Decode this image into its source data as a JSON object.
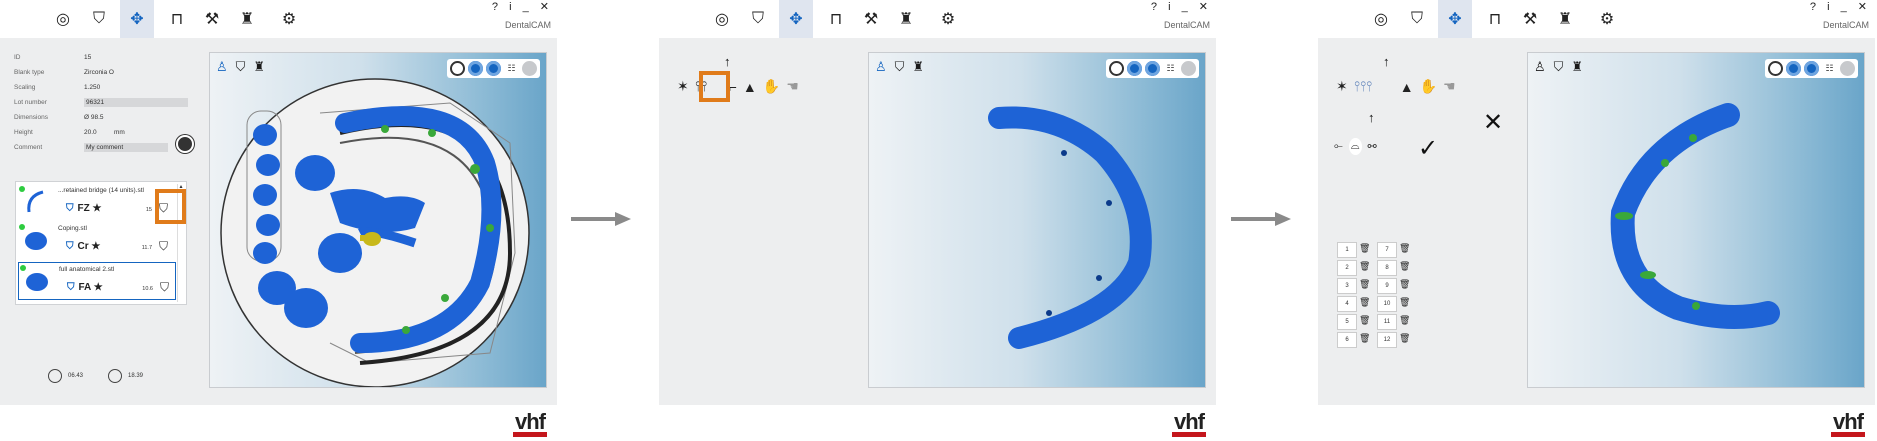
{
  "app_title": "DentalCAM",
  "window_controls": "? i _ ✕",
  "brand": "vhf",
  "toolbar_icons": [
    "blanks-icon",
    "jobs-icon",
    "nesting-icon",
    "machine-icon",
    "tools-icon",
    "maintenance-icon",
    "settings-icon"
  ],
  "properties": [
    {
      "label": "ID",
      "value": "15"
    },
    {
      "label": "Blank type",
      "value": "Zirconia  O"
    },
    {
      "label": "Scaling",
      "value": "1.250"
    },
    {
      "label": "Lot number",
      "value": "96321"
    },
    {
      "label": "Dimensions",
      "value": "Ø 98.5"
    },
    {
      "label": "Height",
      "value": "20.0",
      "unit": "mm"
    },
    {
      "label": "Comment",
      "value": "My comment"
    }
  ],
  "files": [
    {
      "name": "...retained bridge (14 units).stl",
      "material": "FZ",
      "height": "15"
    },
    {
      "name": "Coping.stl",
      "material": "Cr",
      "height": "11.7"
    },
    {
      "name": "full anatomical 2.stl",
      "material": "FA",
      "height": "10.6"
    }
  ],
  "times": {
    "calc": "06.43",
    "mill": "18.39"
  },
  "slots_left": [
    "1",
    "2",
    "3",
    "4",
    "5",
    "6"
  ],
  "slots_right": [
    "7",
    "8",
    "9",
    "10",
    "11",
    "12"
  ],
  "colors": {
    "accent": "#1565c0",
    "highlight": "#e07b1a",
    "brand_red": "#c4161c",
    "model": "#1e63d6"
  }
}
